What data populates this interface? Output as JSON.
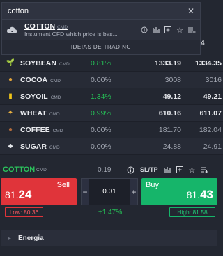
{
  "search": {
    "value": "cotton",
    "placeholder": "",
    "clear_icon": "close-icon"
  },
  "suggestion": {
    "name": "COTTON",
    "tag": "CMD",
    "description": "Instument CFD which price is bas...",
    "icon": "cloud-icon"
  },
  "ideas_label": "IDEIAS DE TRADING",
  "edge_digit": "4",
  "rows": [
    {
      "name": "SOYBEAN",
      "tag": "CMD",
      "change": "0.81%",
      "sell": "1333.19",
      "buy": "1334.35",
      "dir": "pos",
      "icon": "sprout-icon",
      "icon_color": "#3fc46a"
    },
    {
      "name": "COCOA",
      "tag": "CMD",
      "change": "0.00%",
      "sell": "3008",
      "buy": "3016",
      "dir": "zero",
      "icon": "cocoa-icon",
      "icon_color": "#e0a23a"
    },
    {
      "name": "SOYOIL",
      "tag": "CMD",
      "change": "1.34%",
      "sell": "49.12",
      "buy": "49.21",
      "dir": "pos",
      "icon": "oil-bottle-icon",
      "icon_color": "#f0c419"
    },
    {
      "name": "WHEAT",
      "tag": "CMD",
      "change": "0.99%",
      "sell": "610.16",
      "buy": "611.07",
      "dir": "pos",
      "icon": "wheat-icon",
      "icon_color": "#e8b040"
    },
    {
      "name": "COFFEE",
      "tag": "CMD",
      "change": "0.00%",
      "sell": "181.70",
      "buy": "182.04",
      "dir": "zero",
      "icon": "coffee-bean-icon",
      "icon_color": "#b06a3c"
    },
    {
      "name": "SUGAR",
      "tag": "CMD",
      "change": "0.00%",
      "sell": "24.88",
      "buy": "24.91",
      "dir": "zero",
      "icon": "sugar-cube-icon",
      "icon_color": "#e8eaee"
    }
  ],
  "trade": {
    "name": "COTTON",
    "tag": "CMD",
    "spread": "0.19",
    "sltp": "SL/TP",
    "sell_label": "Sell",
    "sell_price_main": "81.",
    "sell_price_big": "24",
    "buy_label": "Buy",
    "buy_price_main": "81.",
    "buy_price_big": "43",
    "quantity": "0.01",
    "minus": "−",
    "plus": "+",
    "low": "Low: 80.36",
    "high": "High: 81.58",
    "change": "+1.47%"
  },
  "category": {
    "label": "Energia",
    "icon": "chevron-right-icon"
  },
  "colors": {
    "positive": "#25c257",
    "sell": "#e0343a",
    "buy": "#16b56a",
    "background": "#232731"
  }
}
